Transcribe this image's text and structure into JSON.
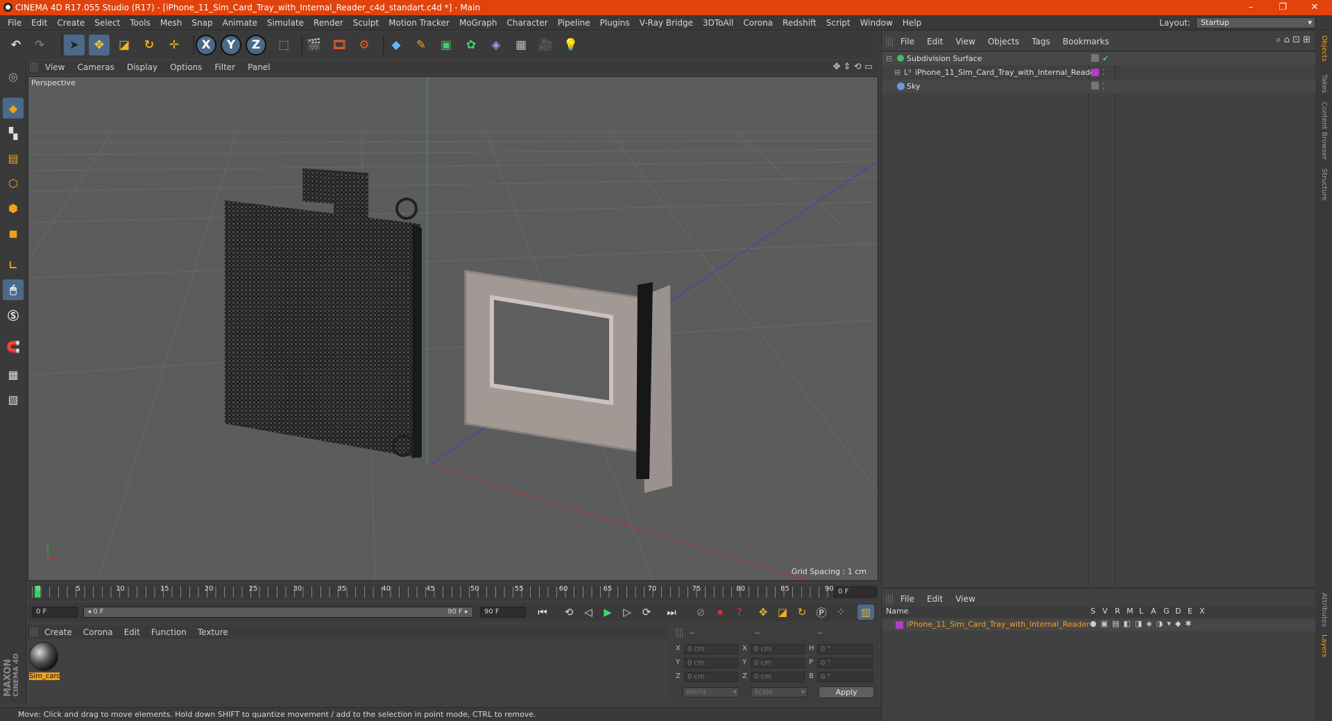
{
  "window": {
    "title": "CINEMA 4D R17.055 Studio (R17) - [iPhone_11_Sim_Card_Tray_with_Internal_Reader_c4d_standart.c4d *] - Main",
    "minimize": "–",
    "restore": "❐",
    "close": "✕"
  },
  "menubar": {
    "items": [
      "File",
      "Edit",
      "Create",
      "Select",
      "Tools",
      "Mesh",
      "Snap",
      "Animate",
      "Simulate",
      "Render",
      "Sculpt",
      "Motion Tracker",
      "MoGraph",
      "Character",
      "Pipeline",
      "Plugins",
      "V-Ray Bridge",
      "3DToAll",
      "Corona",
      "Redshift",
      "Script",
      "Window",
      "Help"
    ],
    "layout_label": "Layout:",
    "layout_value": "Startup"
  },
  "toolbar": {
    "axis_x": "X",
    "axis_y": "Y",
    "axis_z": "Z"
  },
  "viewport": {
    "menu": [
      "View",
      "Cameras",
      "Display",
      "Options",
      "Filter",
      "Panel"
    ],
    "label": "Perspective",
    "grid_spacing": "Grid Spacing : 1 cm"
  },
  "timeline": {
    "ticks": [
      "0",
      "5",
      "10",
      "15",
      "20",
      "25",
      "30",
      "35",
      "40",
      "45",
      "50",
      "55",
      "60",
      "65",
      "70",
      "75",
      "80",
      "85",
      "90"
    ],
    "current_frame": "0 F",
    "start_frame": "0 F",
    "range_start": "◂ 0 F",
    "range_end": "90 F ▸",
    "end_frame": "90 F"
  },
  "material_manager": {
    "menu": [
      "Create",
      "Corona",
      "Edit",
      "Function",
      "Texture"
    ],
    "material_name": "Sim_card"
  },
  "coordinates": {
    "header": [
      "--",
      "--",
      "--"
    ],
    "rows": [
      {
        "l1": "X",
        "v1": "0 cm",
        "l2": "X",
        "v2": "0 cm",
        "l3": "H",
        "v3": "0 °"
      },
      {
        "l1": "Y",
        "v1": "0 cm",
        "l2": "Y",
        "v2": "0 cm",
        "l3": "P",
        "v3": "0 °"
      },
      {
        "l1": "Z",
        "v1": "0 cm",
        "l2": "Z",
        "v2": "0 cm",
        "l3": "B",
        "v3": "0 °"
      }
    ],
    "world": "World",
    "scale": "Scale",
    "apply": "Apply"
  },
  "status": {
    "text": "Move: Click and drag to move elements. Hold down SHIFT to quantize movement / add to the selection in point mode, CTRL to remove."
  },
  "object_manager": {
    "menu": [
      "File",
      "Edit",
      "View",
      "Objects",
      "Tags",
      "Bookmarks"
    ],
    "objects": [
      {
        "name": "Subdivision Surface",
        "color": "#3fbf5f"
      },
      {
        "name": "iPhone_11_Sim_Card_Tray_with_Internal_Reader",
        "color": "#b0b0b0"
      },
      {
        "name": "Sky",
        "color": "#6a9ad8"
      }
    ]
  },
  "layer_manager": {
    "menu": [
      "File",
      "Edit",
      "View"
    ],
    "columns": [
      "Name",
      "S",
      "V",
      "R",
      "M",
      "L",
      "A",
      "G",
      "D",
      "E",
      "X"
    ],
    "layer_name": "iPhone_11_Sim_Card_Tray_with_Internal_Reader",
    "layer_color": "#b23fc4"
  },
  "side_tabs": [
    "Objects",
    "Takes",
    "Content Browser",
    "Structure",
    "Attributes",
    "Layers"
  ],
  "colors": {
    "title_bar": "#e2420b",
    "highlight": "#4b6a8a",
    "selected_text": "#f0a020"
  },
  "branding": {
    "maxon": "MAXON",
    "cinema": "CINEMA 4D"
  }
}
